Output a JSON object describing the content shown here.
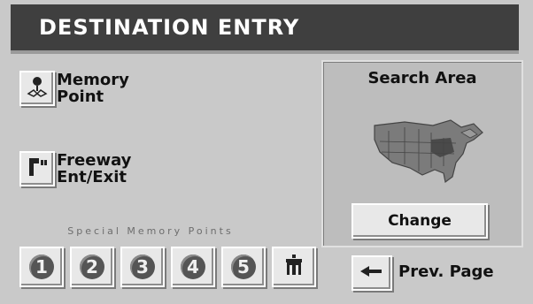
{
  "title": "DESTINATION ENTRY",
  "memory_point": {
    "label_line1": "Memory",
    "label_line2": "Point",
    "icon": "memory-pin-icon"
  },
  "freeway": {
    "label_line1": "Freeway",
    "label_line2": "Ent/Exit",
    "icon": "freeway-exit-icon"
  },
  "special_memory": {
    "label": "Special Memory Points",
    "buttons": [
      "1",
      "2",
      "3",
      "4",
      "5"
    ],
    "home_icon": "home-icon"
  },
  "search_area": {
    "title": "Search Area",
    "map_icon": "north-america-map-icon",
    "change_label": "Change"
  },
  "prev_page": {
    "label": "Prev. Page",
    "icon": "arrow-left-icon"
  }
}
